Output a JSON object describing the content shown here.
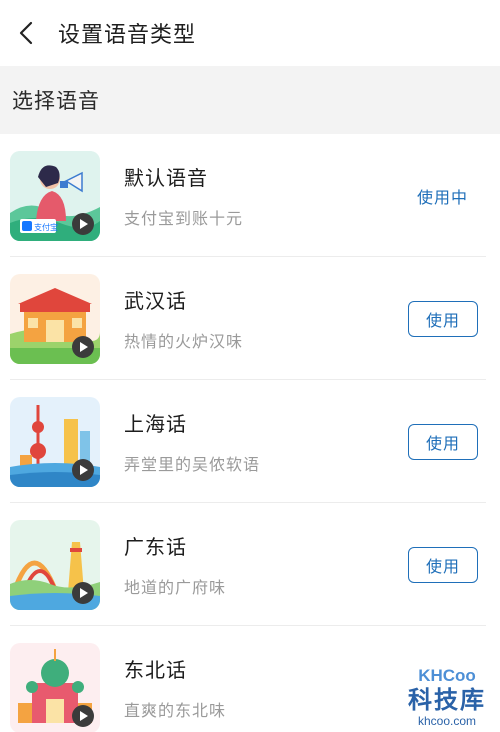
{
  "nav": {
    "title": "设置语音类型"
  },
  "section": {
    "title": "选择语音"
  },
  "voices": [
    {
      "name": "默认语音",
      "desc": "支付宝到账十元",
      "status": "使用中",
      "thumb_label": "支付宝"
    },
    {
      "name": "武汉话",
      "desc": "热情的火炉汉味",
      "action": "使用"
    },
    {
      "name": "上海话",
      "desc": "弄堂里的吴侬软语",
      "action": "使用"
    },
    {
      "name": "广东话",
      "desc": "地道的广府味",
      "action": "使用"
    },
    {
      "name": "东北话",
      "desc": "直爽的东北味"
    }
  ],
  "watermark": {
    "logo": "KHCoo",
    "name": "科技库",
    "url": "khcoo.com"
  },
  "colors": {
    "accent": "#1f6fb9",
    "section_bg": "#f3f3f3",
    "muted": "#9a9a9a"
  },
  "icons": {
    "back": "chevron-left-icon",
    "play": "play-icon"
  }
}
